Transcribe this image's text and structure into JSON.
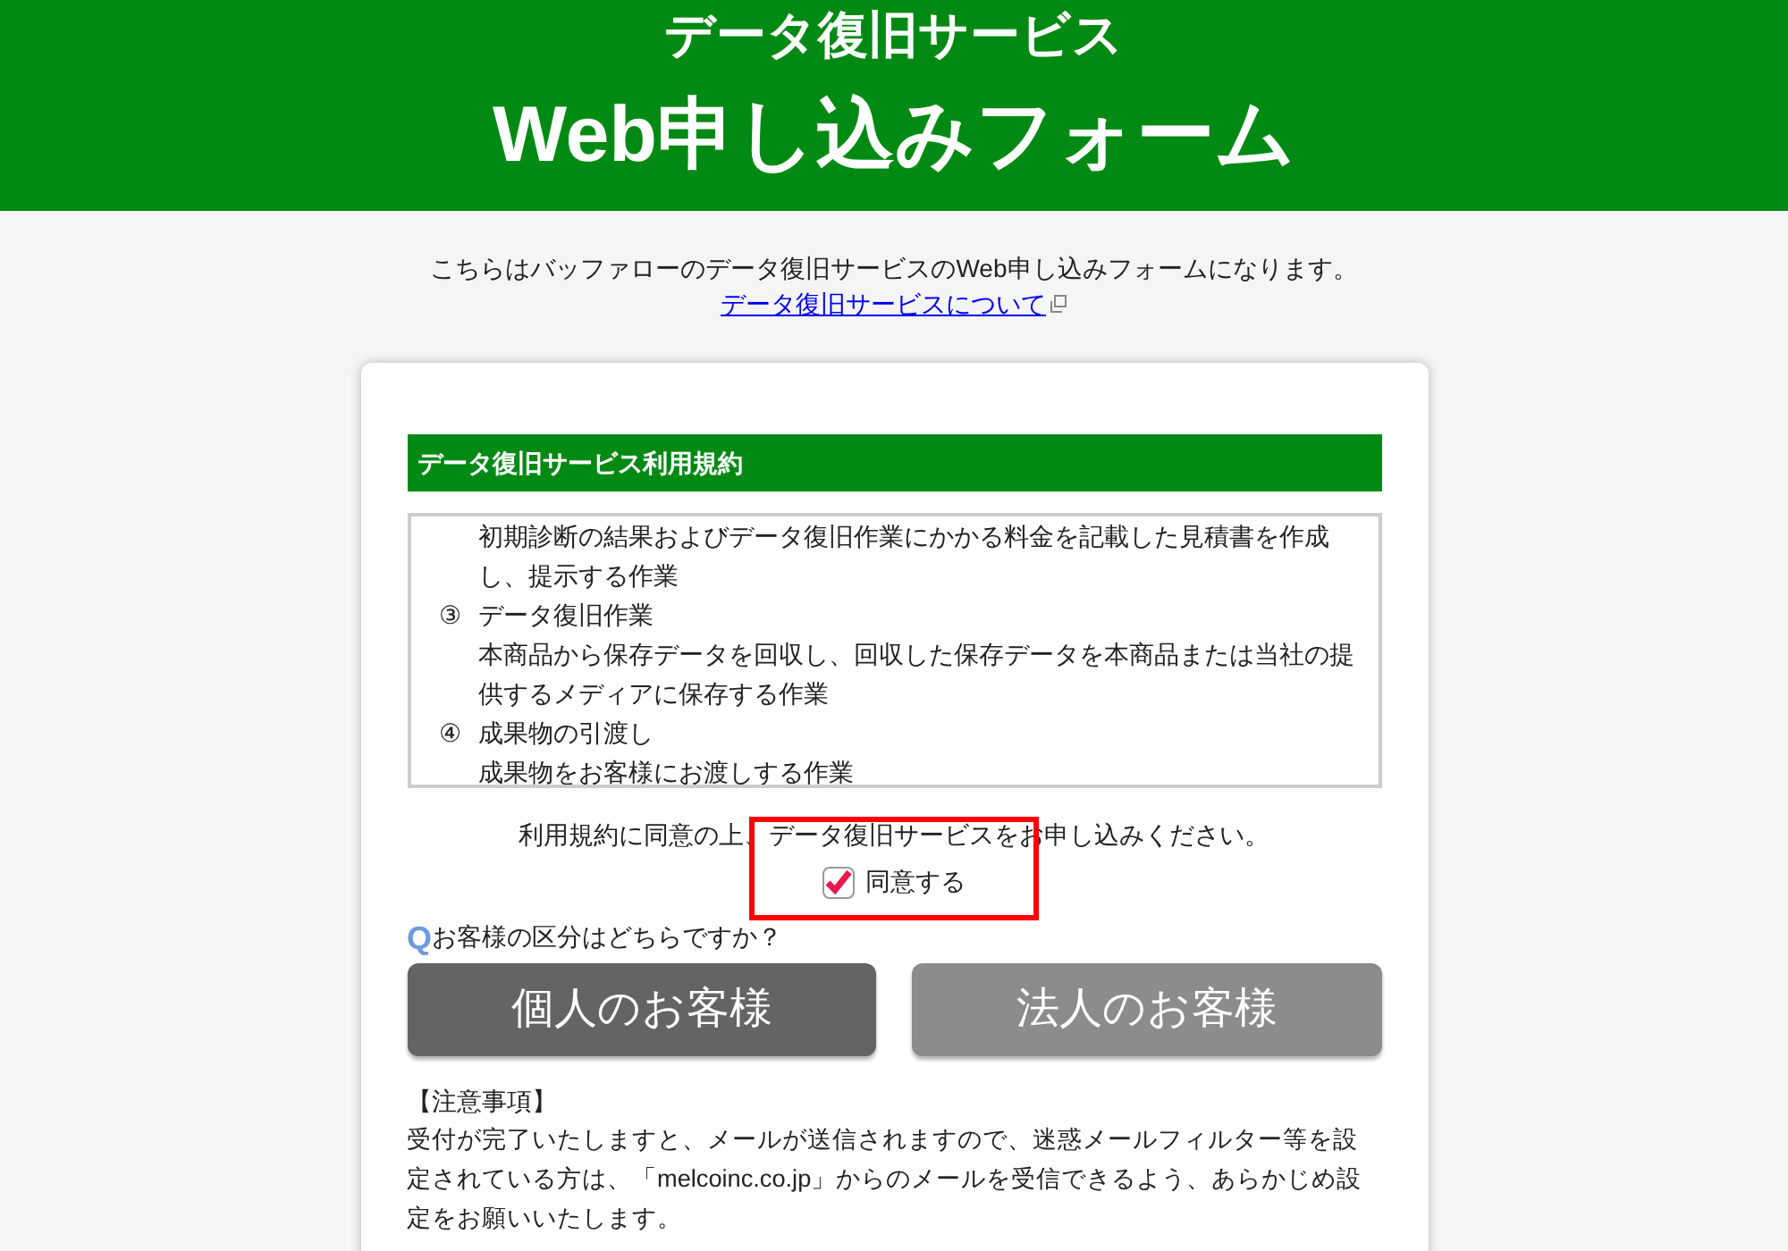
{
  "header": {
    "subtitle": "データ復旧サービス",
    "title": "Web申し込みフォーム"
  },
  "intro": {
    "text": "こちらはバッファローのデータ復旧サービスのWeb申し込みフォームになります。",
    "link": "データ復旧サービスについて"
  },
  "terms": {
    "heading": "データ復旧サービス利用規約",
    "items": [
      {
        "marker": "",
        "text": "初期診断の結果およびデータ復旧作業にかかる料金を記載した見積書を作成し、提示する作業"
      },
      {
        "marker": "③",
        "text": "データ復旧作業"
      },
      {
        "marker": "",
        "text": "本商品から保存データを回収し、回収した保存データを本商品または当社の提供するメディアに保存する作業"
      },
      {
        "marker": "④",
        "text": "成果物の引渡し"
      },
      {
        "marker": "",
        "text": "成果物をお客様にお渡しする作業"
      }
    ]
  },
  "agreement": {
    "prompt": "利用規約に同意の上、データ復旧サービスをお申し込みください。",
    "checkbox": {
      "label": "同意する",
      "checked": true
    },
    "highlighted": true
  },
  "question": {
    "mark": "Q",
    "text": "お客様の区分はどちらですか？",
    "options": [
      {
        "label": "個人のお客様",
        "selected": true
      },
      {
        "label": "法人のお客様",
        "selected": false
      }
    ]
  },
  "notes": {
    "heading": "【注意事項】",
    "text": "受付が完了いたしますと、メールが送信されますので、迷惑メールフィルター等を設定されている方は、「melcoinc.co.jp」からのメールを受信できるよう、あらかじめ設定をお願いいたします。"
  }
}
